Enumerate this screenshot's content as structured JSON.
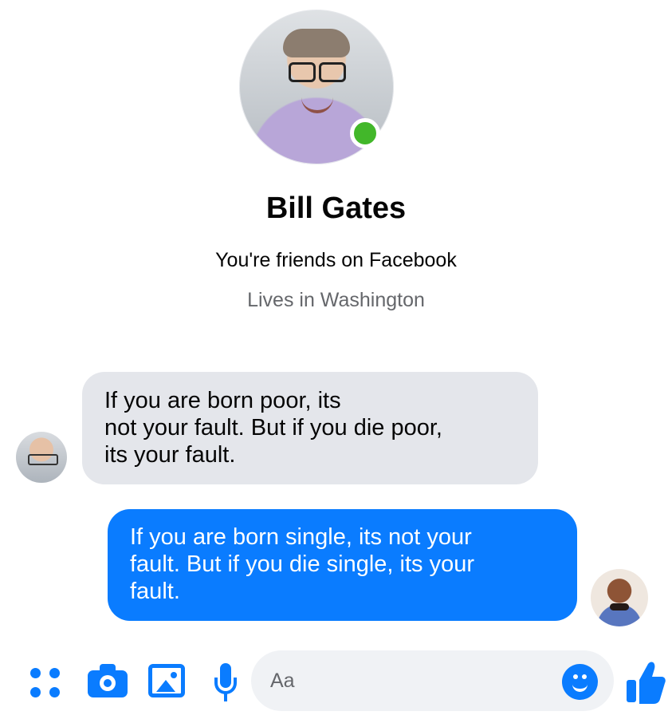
{
  "contact": {
    "name": "Bill Gates",
    "friendship": "You're friends on Facebook",
    "location": "Lives in Washington",
    "online": true
  },
  "messages": [
    {
      "direction": "incoming",
      "text": "If you are born poor, its\nnot your fault. But if you die poor,\nits your fault."
    },
    {
      "direction": "outgoing",
      "text": "If you are born single, its not your\nfault. But if you die single, its your\nfault."
    }
  ],
  "composer": {
    "placeholder": "Aa",
    "icons": [
      "grid-dots-icon",
      "camera-icon",
      "image-icon",
      "microphone-icon",
      "emoji-icon",
      "thumbs-up-icon"
    ]
  },
  "colors": {
    "messenger_blue": "#0a7cff",
    "incoming_bubble": "#e4e6eb",
    "online_green": "#42b72a"
  }
}
